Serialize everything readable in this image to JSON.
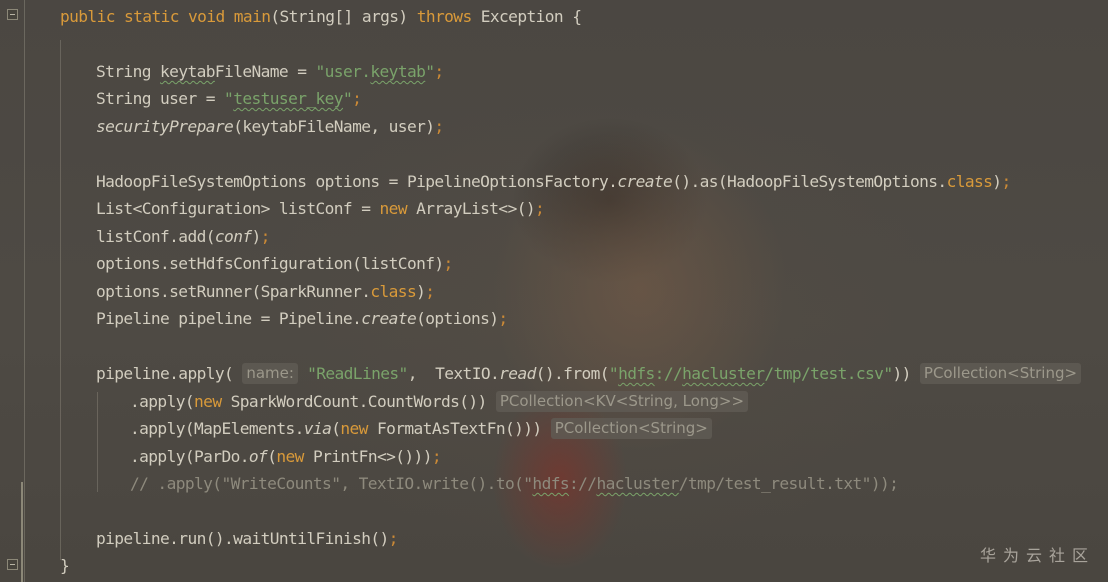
{
  "editor": {
    "lines": [
      {
        "key": "l1",
        "parts": [
          {
            "t": "public static void ",
            "c": "kw"
          },
          {
            "t": "main",
            "c": "kw"
          },
          {
            "t": "(String[] args) "
          },
          {
            "t": "throws",
            "c": "kw"
          },
          {
            "t": " Exception {"
          }
        ]
      },
      {
        "key": "l3",
        "parts": [
          {
            "t": "String "
          },
          {
            "t": "keytab",
            "c": "squig"
          },
          {
            "t": "FileName = "
          },
          {
            "t": "\"user.",
            "c": "str"
          },
          {
            "t": "keytab",
            "c": "str squig"
          },
          {
            "t": "\"",
            "c": "str"
          },
          {
            "t": ";",
            "c": "punc"
          }
        ]
      },
      {
        "key": "l4",
        "parts": [
          {
            "t": "String user = "
          },
          {
            "t": "\"",
            "c": "str"
          },
          {
            "t": "testuser_key",
            "c": "str squig"
          },
          {
            "t": "\"",
            "c": "str"
          },
          {
            "t": ";",
            "c": "punc"
          }
        ]
      },
      {
        "key": "l5",
        "parts": [
          {
            "t": "securityPrepare",
            "c": "it"
          },
          {
            "t": "(keytabFileName, user)"
          },
          {
            "t": ";",
            "c": "punc"
          }
        ]
      },
      {
        "key": "l7",
        "parts": [
          {
            "t": "HadoopFileSystemOptions options = PipelineOptionsFactory."
          },
          {
            "t": "create",
            "c": "it"
          },
          {
            "t": "().as(HadoopFileSystemOptions."
          },
          {
            "t": "class",
            "c": "kw"
          },
          {
            "t": ")"
          },
          {
            "t": ";",
            "c": "punc"
          }
        ]
      },
      {
        "key": "l8",
        "parts": [
          {
            "t": "List<Configuration> listConf = "
          },
          {
            "t": "new",
            "c": "kw"
          },
          {
            "t": " ArrayList<>()"
          },
          {
            "t": ";",
            "c": "punc"
          }
        ]
      },
      {
        "key": "l9",
        "parts": [
          {
            "t": "listConf.add("
          },
          {
            "t": "conf",
            "c": "it"
          },
          {
            "t": ")"
          },
          {
            "t": ";",
            "c": "punc"
          }
        ]
      },
      {
        "key": "l10",
        "parts": [
          {
            "t": "options.setHdfsConfiguration(listConf)"
          },
          {
            "t": ";",
            "c": "punc"
          }
        ]
      },
      {
        "key": "l11",
        "parts": [
          {
            "t": "options.setRunner(SparkRunner."
          },
          {
            "t": "class",
            "c": "kw"
          },
          {
            "t": ")"
          },
          {
            "t": ";",
            "c": "punc"
          }
        ]
      },
      {
        "key": "l12",
        "parts": [
          {
            "t": "Pipeline pipeline = Pipeline."
          },
          {
            "t": "create",
            "c": "it"
          },
          {
            "t": "(options)"
          },
          {
            "t": ";",
            "c": "punc"
          }
        ]
      },
      {
        "key": "l14",
        "parts": [
          {
            "t": "pipeline.apply( "
          },
          {
            "t": "name:",
            "c": "hint"
          },
          {
            "t": " \"ReadLines\"",
            "c": "str"
          },
          {
            "t": ",  TextIO."
          },
          {
            "t": "read",
            "c": "it"
          },
          {
            "t": "().from("
          },
          {
            "t": "\"",
            "c": "str"
          },
          {
            "t": "hdfs",
            "c": "str squig"
          },
          {
            "t": "://",
            "c": "str"
          },
          {
            "t": "hacluster",
            "c": "str squig"
          },
          {
            "t": "/tmp/test.csv\"",
            "c": "str"
          },
          {
            "t": ")) "
          },
          {
            "t": "PCollection<String>",
            "c": "hint"
          }
        ]
      },
      {
        "key": "l15",
        "parts": [
          {
            "t": ".apply("
          },
          {
            "t": "new",
            "c": "kw"
          },
          {
            "t": " SparkWordCount.CountWords()) "
          },
          {
            "t": "PCollection<KV<String, Long>>",
            "c": "hint"
          }
        ]
      },
      {
        "key": "l16",
        "parts": [
          {
            "t": ".apply(MapElements."
          },
          {
            "t": "via",
            "c": "it"
          },
          {
            "t": "("
          },
          {
            "t": "new",
            "c": "kw"
          },
          {
            "t": " FormatAsTextFn())) "
          },
          {
            "t": "PCollection<String>",
            "c": "hint"
          }
        ]
      },
      {
        "key": "l17",
        "parts": [
          {
            "t": ".apply(ParDo."
          },
          {
            "t": "of",
            "c": "it"
          },
          {
            "t": "("
          },
          {
            "t": "new",
            "c": "kw"
          },
          {
            "t": " PrintFn<>()))"
          },
          {
            "t": ";",
            "c": "punc"
          }
        ]
      },
      {
        "key": "l18",
        "parts": [
          {
            "t": "// .apply(\"WriteCounts\", TextIO.write().to(\"",
            "c": "comment"
          },
          {
            "t": "hdfs",
            "c": "comment squig"
          },
          {
            "t": "://",
            "c": "comment"
          },
          {
            "t": "hacluster",
            "c": "comment squig"
          },
          {
            "t": "/tmp/test_result.txt\"));",
            "c": "comment"
          }
        ]
      },
      {
        "key": "l20",
        "parts": [
          {
            "t": "pipeline.run().waitUntilFinish()"
          },
          {
            "t": ";",
            "c": "punc"
          }
        ]
      },
      {
        "key": "l21",
        "parts": [
          {
            "t": "}"
          }
        ]
      }
    ]
  },
  "watermark": {
    "text": "华为云社区"
  }
}
